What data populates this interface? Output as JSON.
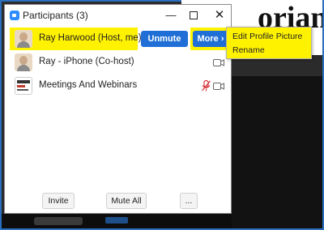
{
  "window": {
    "title": "Participants (3)",
    "controls": {
      "minimize": "—",
      "close": "✕"
    }
  },
  "background": {
    "heading_fragment": "orians"
  },
  "participants": [
    {
      "name": "Ray Harwood (Host, me)",
      "avatar": "person-photo-icon",
      "actions": {
        "unmute": "Unmute",
        "more": "More ›"
      }
    },
    {
      "name": "Ray - iPhone (Co-host)",
      "avatar": "person-photo-icon",
      "status_icons": [
        "video-camera-icon"
      ]
    },
    {
      "name": "Meetings And Webinars",
      "avatar": "logo-icon",
      "status_icons": [
        "muted-mic-icon",
        "video-camera-icon"
      ]
    }
  ],
  "footer": {
    "invite": "Invite",
    "mute_all": "Mute All",
    "more": "..."
  },
  "context_menu": {
    "items": [
      "Edit Profile Picture",
      "Rename"
    ]
  },
  "colors": {
    "highlight": "#fff200",
    "button_blue": "#1f6fd6",
    "muted_red": "#d9363e",
    "frame_blue": "#2a6fbf"
  }
}
